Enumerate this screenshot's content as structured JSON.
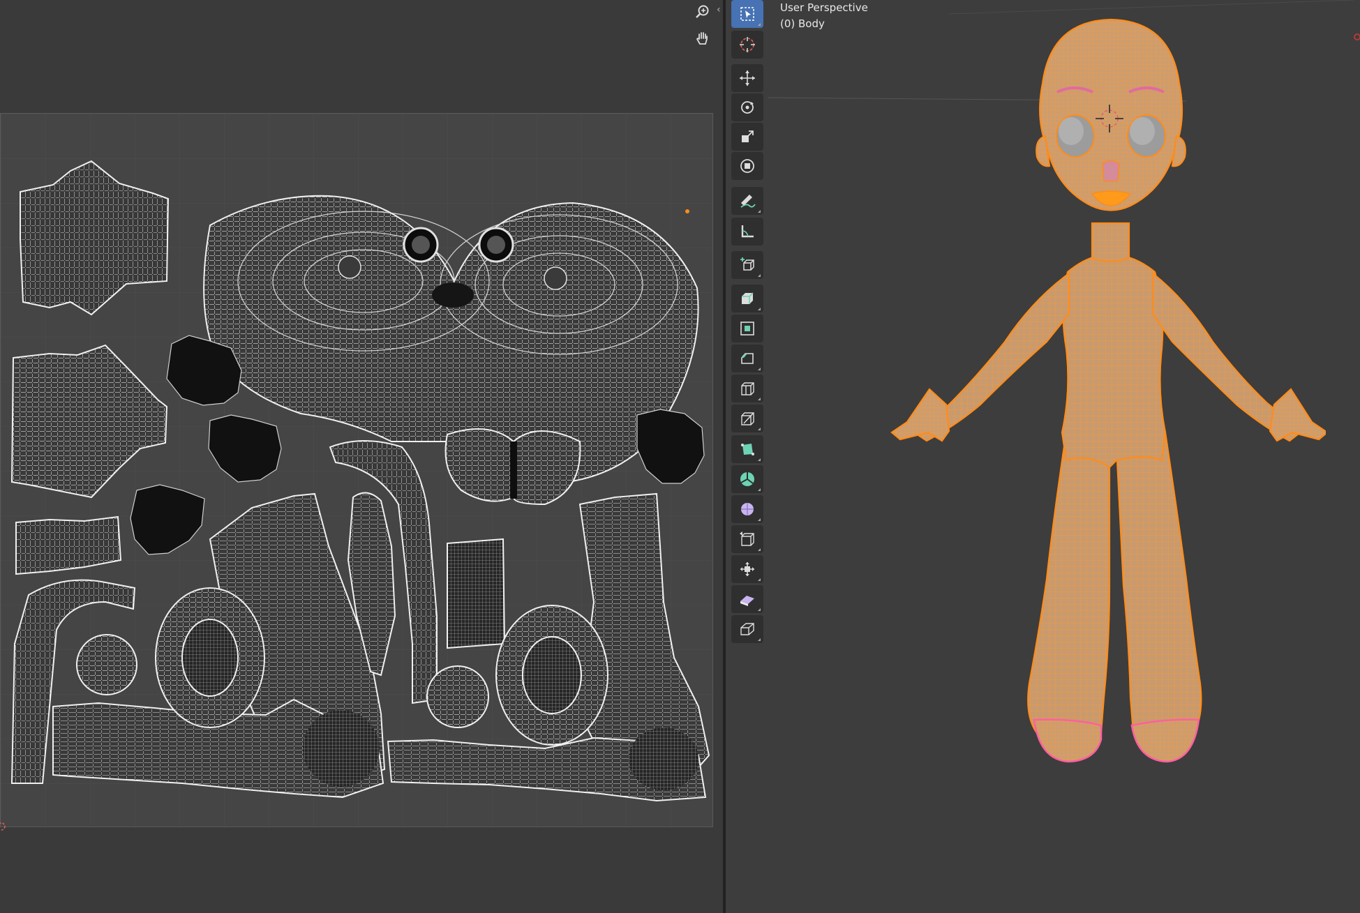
{
  "viewport": {
    "view_name": "User Perspective",
    "object_label": "(0) Body"
  },
  "uv_editor": {
    "nav_icons": [
      "zoom-icon",
      "hand-pan-icon"
    ],
    "collapse_icon": "chevron-left-icon"
  },
  "toolbar": {
    "tools": [
      {
        "name": "select-box",
        "active": true
      },
      {
        "name": "cursor"
      },
      {
        "name": "move"
      },
      {
        "name": "rotate"
      },
      {
        "name": "scale"
      },
      {
        "name": "transform"
      },
      {
        "name": "annotate"
      },
      {
        "name": "measure"
      },
      {
        "name": "add-cube"
      },
      {
        "name": "extrude-region"
      },
      {
        "name": "inset-faces"
      },
      {
        "name": "bevel"
      },
      {
        "name": "loop-cut"
      },
      {
        "name": "knife"
      },
      {
        "name": "poly-build"
      },
      {
        "name": "spin"
      },
      {
        "name": "smooth"
      },
      {
        "name": "edge-slide"
      },
      {
        "name": "shrink-fatten"
      },
      {
        "name": "shear"
      },
      {
        "name": "rip-region"
      }
    ]
  },
  "colors": {
    "background": "#3b3b3b",
    "uv_background": "#454545",
    "mesh_wire": "#ececec",
    "selection_orange": "#ff8c1a",
    "active_tool": "#4772b3",
    "toolbar_button": "#2f2f2f"
  }
}
